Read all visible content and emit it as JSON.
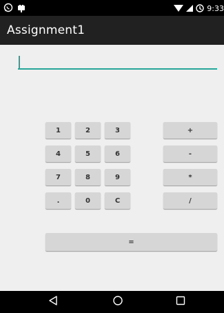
{
  "status_bar": {
    "time": "9:33",
    "icons": [
      "whatsapp-icon",
      "app-notification-icon",
      "wifi-icon",
      "signal-icon",
      "battery-icon"
    ]
  },
  "app_bar": {
    "title": "Assignment1"
  },
  "input": {
    "value": ""
  },
  "keypad": {
    "digits": [
      [
        "1",
        "2",
        "3"
      ],
      [
        "4",
        "5",
        "6"
      ],
      [
        "7",
        "8",
        "9"
      ],
      [
        ".",
        "0",
        "C"
      ]
    ],
    "operators": [
      "+",
      "-",
      "*",
      "/"
    ],
    "equals": "="
  },
  "nav_bar": {
    "icons": [
      "back-icon",
      "home-icon",
      "recents-icon"
    ]
  },
  "colors": {
    "accent": "#26a69a",
    "app_bar": "#212121",
    "background": "#efefef",
    "button": "#d6d6d6"
  }
}
